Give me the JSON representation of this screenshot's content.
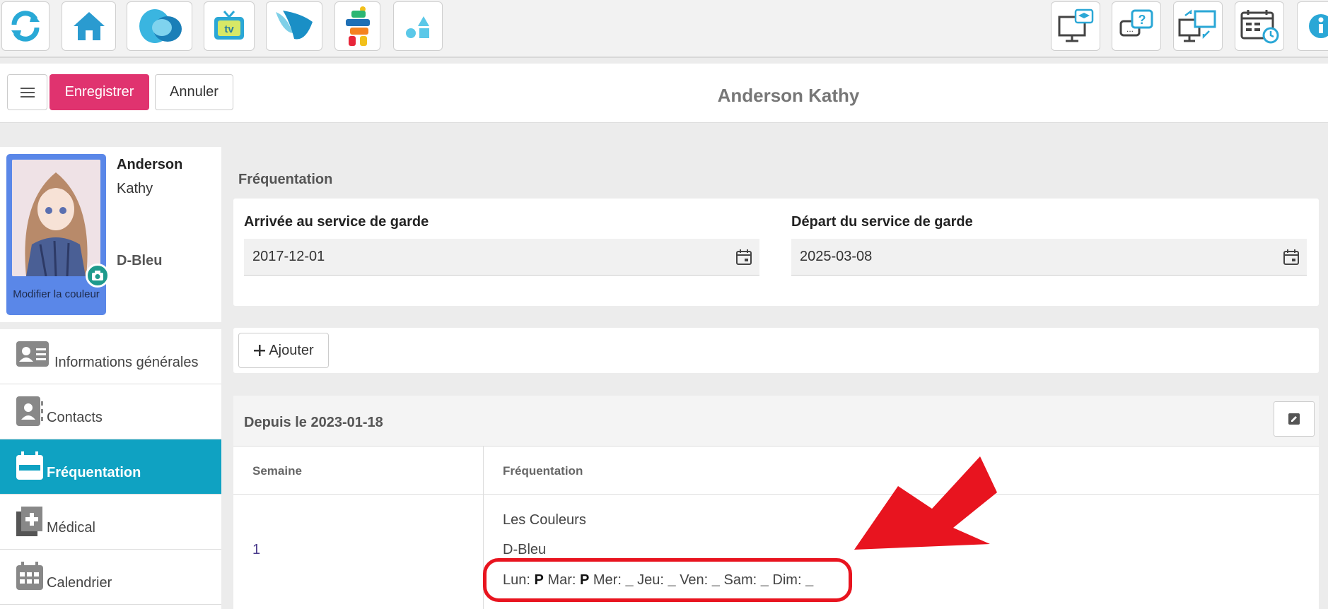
{
  "toolbar": {
    "left_buttons": [
      "refresh-icon",
      "home-icon",
      "app-logo-icon",
      "tv-icon",
      "butterfly-icon",
      "inukshuk-icon",
      "shapes-icon"
    ],
    "right_buttons": [
      "training-icon",
      "help-icon",
      "remote-icon",
      "schedule-icon",
      "info-icon"
    ]
  },
  "actions": {
    "save_label": "Enregistrer",
    "cancel_label": "Annuler",
    "save_color": "#e0336f"
  },
  "page_title": "Anderson Kathy",
  "profile": {
    "last_name": "Anderson",
    "first_name": "Kathy",
    "group": "D-Bleu",
    "photo_caption": "Modifier la couleur",
    "card_color": "#5a87e8"
  },
  "sidebar": {
    "items": [
      {
        "label": "Informations générales",
        "icon": "id-card-icon",
        "active": false
      },
      {
        "label": "Contacts",
        "icon": "address-book-icon",
        "active": false
      },
      {
        "label": "Fréquentation",
        "icon": "calendar-icon",
        "active": true
      },
      {
        "label": "Médical",
        "icon": "medical-file-icon",
        "active": false
      },
      {
        "label": "Calendrier",
        "icon": "calendar-grid-icon",
        "active": false
      }
    ],
    "active_color": "#0fa2c2"
  },
  "main": {
    "section_title": "Fréquentation",
    "arrival": {
      "label": "Arrivée au service de garde",
      "value": "2017-12-01"
    },
    "departure": {
      "label": "Départ du service de garde",
      "value": "2025-03-08"
    },
    "add_label": "Ajouter",
    "schedule": {
      "since": "Depuis le 2023-01-18",
      "columns": [
        "Semaine",
        "Fréquentation"
      ],
      "rows": [
        {
          "week": "1",
          "program": "Les Couleurs",
          "group": "D-Bleu",
          "days": [
            {
              "day": "Lun:",
              "value": "P"
            },
            {
              "day": "Mar:",
              "value": "P"
            },
            {
              "day": "Mer:",
              "value": "_"
            },
            {
              "day": "Jeu:",
              "value": "_"
            },
            {
              "day": "Ven:",
              "value": "_"
            },
            {
              "day": "Sam:",
              "value": "_"
            },
            {
              "day": "Dim:",
              "value": "_"
            }
          ]
        }
      ]
    }
  },
  "annotation": {
    "color": "#e8141f"
  }
}
